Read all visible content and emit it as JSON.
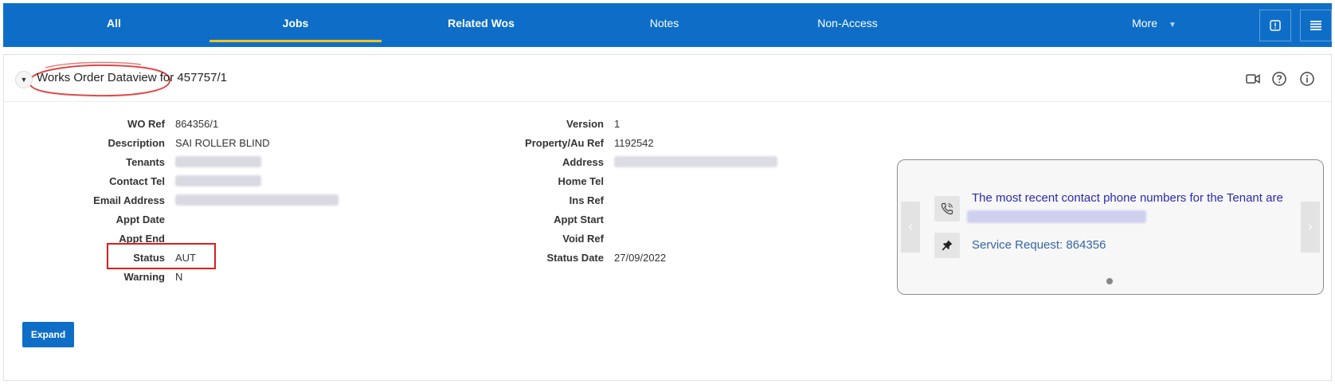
{
  "nav": {
    "tabs": [
      {
        "label": "All"
      },
      {
        "label": "Jobs"
      },
      {
        "label": "Related Wos"
      },
      {
        "label": "Notes"
      },
      {
        "label": "Non-Access"
      }
    ],
    "more_label": "More",
    "accent_color": "#0e6ec7",
    "active_underline_color": "#f4c31b",
    "active_tab": "Jobs",
    "right_icons": [
      "alert-icon",
      "menu-icon"
    ]
  },
  "panel": {
    "title": "Works Order Dataview for 457757/1",
    "header_icons": [
      "video-camera-icon",
      "help-icon",
      "info-icon"
    ]
  },
  "fields_left": [
    {
      "label": "WO Ref",
      "value": "864356/1"
    },
    {
      "label": "Description",
      "value": "SAI ROLLER BLIND"
    },
    {
      "label": "Tenants",
      "value": "",
      "redacted": true
    },
    {
      "label": "Contact Tel",
      "value": "",
      "redacted": true
    },
    {
      "label": "Email Address",
      "value": "",
      "redacted": true
    },
    {
      "label": "Appt Date",
      "value": ""
    },
    {
      "label": "Appt End",
      "value": ""
    },
    {
      "label": "Status",
      "value": "AUT"
    },
    {
      "label": "Warning",
      "value": "N"
    }
  ],
  "fields_right": [
    {
      "label": "Version",
      "value": "1"
    },
    {
      "label": "Property/Au Ref",
      "value": "1192542"
    },
    {
      "label": "Address",
      "value": "",
      "redacted": true
    },
    {
      "label": "Home Tel",
      "value": ""
    },
    {
      "label": "Ins Ref",
      "value": ""
    },
    {
      "label": "Appt Start",
      "value": ""
    },
    {
      "label": "Void Ref",
      "value": ""
    },
    {
      "label": "Status Date",
      "value": "27/09/2022"
    }
  ],
  "expand_label": "Expand",
  "carousel": {
    "message": "The most recent contact phone numbers for the Tenant are",
    "service_request": "Service Request: 864356",
    "message_color": "#2a2ab0",
    "link_color": "#3566a6"
  }
}
